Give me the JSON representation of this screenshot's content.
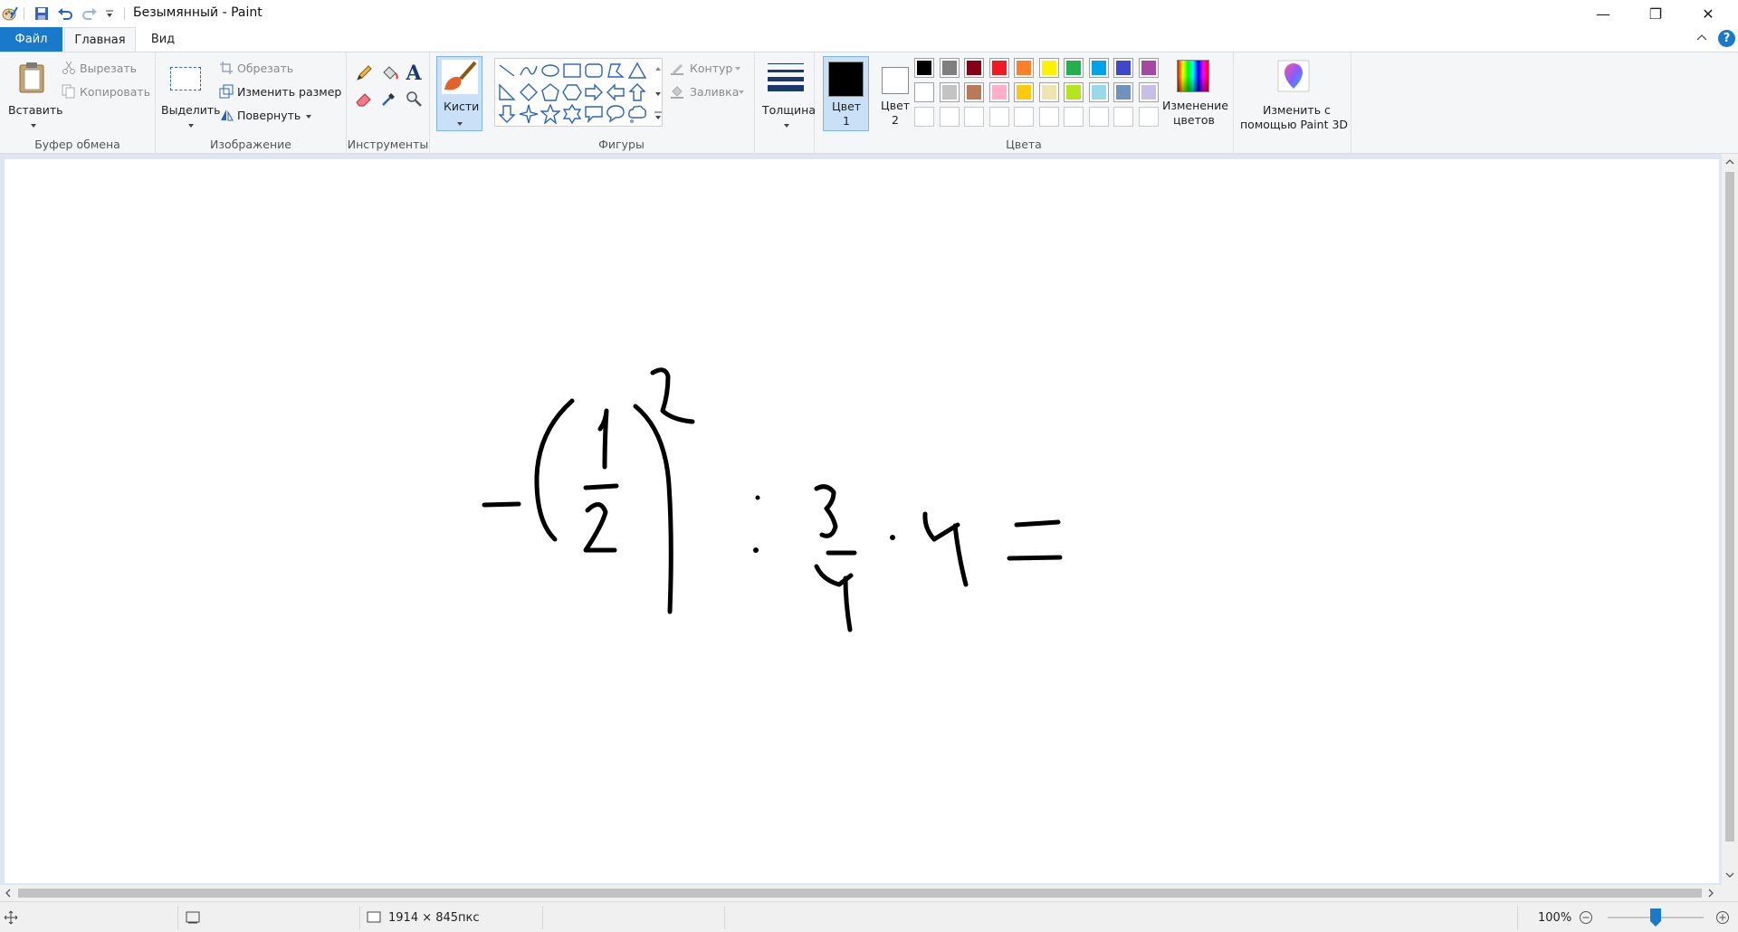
{
  "window": {
    "title": "Безымянный - Paint",
    "min_symbol": "—",
    "restore_symbol": "❐",
    "close_symbol": "✕"
  },
  "tabs": {
    "file": "Файл",
    "home": "Главная",
    "view": "Вид"
  },
  "clipboard": {
    "paste": "Вставить",
    "cut": "Вырезать",
    "copy": "Копировать",
    "group": "Буфер обмена"
  },
  "image": {
    "select": "Выделить",
    "crop": "Обрезать",
    "resize": "Изменить размер",
    "rotate": "Повернуть",
    "group": "Изображение"
  },
  "tools": {
    "group": "Инструменты",
    "text_glyph": "A"
  },
  "brushes": {
    "label": "Кисти"
  },
  "shapes": {
    "outline": "Контур",
    "fill": "Заливка",
    "group": "Фигуры"
  },
  "size": {
    "label": "Толщина"
  },
  "colors": {
    "color1_label_a": "Цвет",
    "color1_label_b": "1",
    "color2_label_a": "Цвет",
    "color2_label_b": "2",
    "edit_label_a": "Изменение",
    "edit_label_b": "цветов",
    "group": "Цвета",
    "color1": "#000000",
    "color2": "#ffffff",
    "palette_row1": [
      "#000000",
      "#7f7f7f",
      "#880015",
      "#ed1c24",
      "#ff7f27",
      "#fff200",
      "#22b14c",
      "#00a2e8",
      "#3f48cc",
      "#a349a4"
    ],
    "palette_row2": [
      "#ffffff",
      "#c3c3c3",
      "#b97a57",
      "#ffaec9",
      "#ffc90e",
      "#efe4b0",
      "#b5e61d",
      "#99d9ea",
      "#7092be",
      "#c8bfe7"
    ]
  },
  "paint3d": {
    "label_a": "Изменить с",
    "label_b": "помощью Paint 3D"
  },
  "status": {
    "canvas_size": "1914 × 845пкс",
    "zoom": "100%",
    "zoom_fraction": 0.5
  }
}
